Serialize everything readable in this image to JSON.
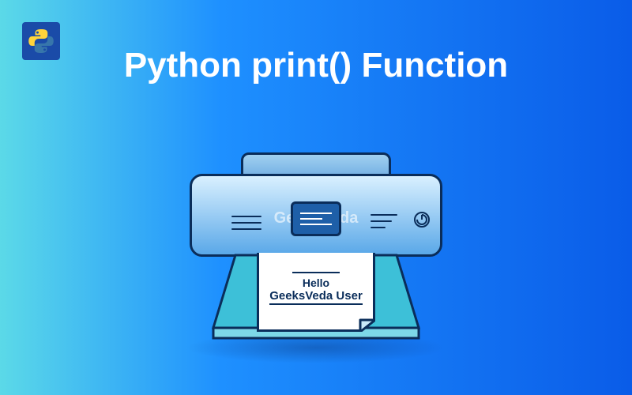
{
  "title": "Python print() Function",
  "watermark": "GeeksVeda",
  "paper": {
    "line1": "Hello",
    "line2": "GeeksVeda User"
  },
  "colors": {
    "bg_start": "#5bd9e8",
    "bg_end": "#0a5ce8",
    "outline": "#0a2d5a"
  }
}
